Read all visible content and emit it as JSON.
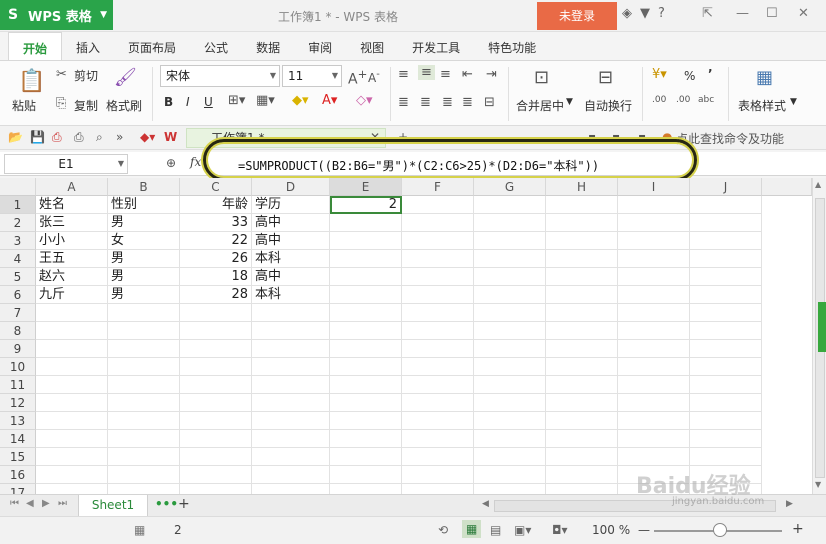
{
  "app": {
    "name": "WPS 表格",
    "logo_char": "S"
  },
  "window": {
    "title": "工作簿1 * - WPS 表格",
    "login_label": "未登录"
  },
  "tabs": [
    "开始",
    "插入",
    "页面布局",
    "公式",
    "数据",
    "审阅",
    "视图",
    "开发工具",
    "特色功能"
  ],
  "ribbon": {
    "paste": "粘贴",
    "cut": "剪切",
    "copy": "复制",
    "format_painter": "格式刷",
    "font_name": "宋体",
    "font_size": "11",
    "bold": "B",
    "italic": "I",
    "underline": "U",
    "merge": "合并居中",
    "wrap": "自动换行",
    "percent": "%",
    "comma": "’",
    "table_style": "表格样式"
  },
  "quickbar": {
    "doc_tab": "工作簿1 *",
    "search_hint": "点此查找命令及功能"
  },
  "formula_bar": {
    "name_box": "E1",
    "fx": "fx",
    "formula": "=SUMPRODUCT((B2:B6=\"男\")*(C2:C6>25)*(D2:D6=\"本科\"))"
  },
  "columns": [
    "A",
    "B",
    "C",
    "D",
    "E",
    "F",
    "G",
    "H",
    "I",
    "J"
  ],
  "rows": [
    "1",
    "2",
    "3",
    "4",
    "5",
    "6",
    "7",
    "8",
    "9",
    "10",
    "11",
    "12",
    "13",
    "14",
    "15",
    "16",
    "17"
  ],
  "cells": {
    "A1": "姓名",
    "B1": "性别",
    "C1": "年龄",
    "D1": "学历",
    "E1": "2",
    "A2": "张三",
    "B2": "男",
    "C2": "33",
    "D2": "高中",
    "A3": "小小",
    "B3": "女",
    "C3": "22",
    "D3": "高中",
    "A4": "王五",
    "B4": "男",
    "C4": "26",
    "D4": "本科",
    "A5": "赵六",
    "B5": "男",
    "C5": "18",
    "D5": "高中",
    "A6": "九斤",
    "B6": "男",
    "C6": "28",
    "D6": "本科"
  },
  "sheets": {
    "active": "Sheet1",
    "add": "+"
  },
  "status": {
    "value": "2",
    "zoom": "100 %"
  },
  "watermark": {
    "brand": "Baidu经验",
    "url": "jingyan.baidu.com"
  }
}
